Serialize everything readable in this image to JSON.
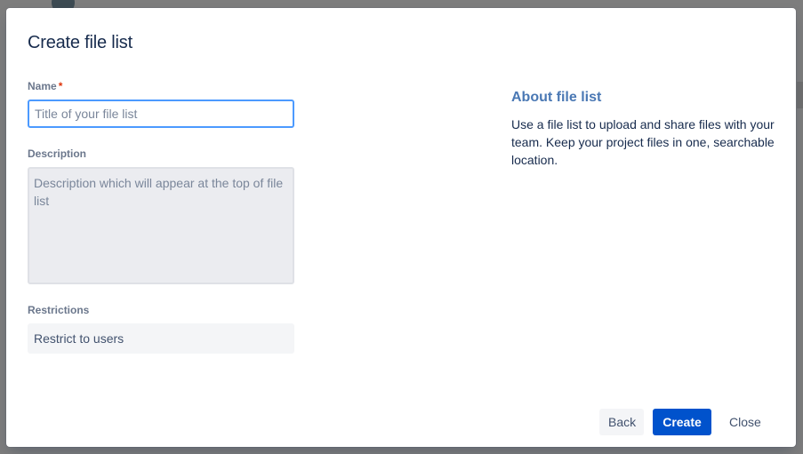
{
  "modal": {
    "title": "Create file list"
  },
  "form": {
    "name": {
      "label": "Name",
      "required_mark": "*",
      "value": "",
      "placeholder": "Title of your file list"
    },
    "description": {
      "label": "Description",
      "value": "",
      "placeholder": "Description which will appear at the top of file list"
    },
    "restrictions": {
      "label": "Restrictions",
      "selected": "Restrict to users"
    }
  },
  "about": {
    "heading": "About file list",
    "text": "Use a file list to upload and share files with your team. Keep your project files in one, searchable location."
  },
  "footer": {
    "back_label": "Back",
    "create_label": "Create",
    "close_label": "Close"
  },
  "colors": {
    "primary": "#0052cc",
    "focus_border": "#4c9aff",
    "required": "#de350b",
    "about_heading": "#4a78b4"
  }
}
